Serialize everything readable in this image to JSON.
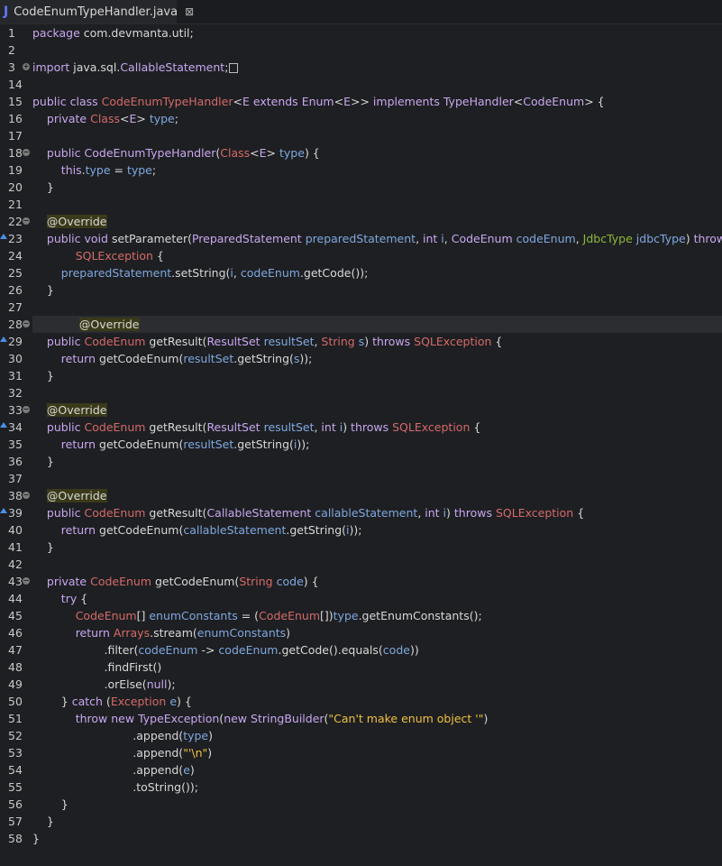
{
  "tab": {
    "icon": "java-file-icon",
    "title": "CodeEnumTypeHandler.java",
    "close_glyph": "⊠"
  },
  "lines": [
    {
      "n": "1",
      "t": "package com.devmanta.util;"
    },
    {
      "n": "2",
      "t": ""
    },
    {
      "n": "3",
      "t": "import java.sql.CallableStatement;"
    },
    {
      "n": "14",
      "t": ""
    },
    {
      "n": "15",
      "t": "public class CodeEnumTypeHandler<E extends Enum<E>> implements TypeHandler<CodeEnum> {"
    },
    {
      "n": "16",
      "t": "    private Class<E> type;"
    },
    {
      "n": "17",
      "t": ""
    },
    {
      "n": "18",
      "t": "    public CodeEnumTypeHandler(Class<E> type) {"
    },
    {
      "n": "19",
      "t": "        this.type = type;"
    },
    {
      "n": "20",
      "t": "    }"
    },
    {
      "n": "21",
      "t": ""
    },
    {
      "n": "22",
      "t": "    @Override"
    },
    {
      "n": "23",
      "t": "    public void setParameter(PreparedStatement preparedStatement, int i, CodeEnum codeEnum, JdbcType jdbcType) throws"
    },
    {
      "n": "24",
      "t": "            SQLException {"
    },
    {
      "n": "25",
      "t": "        preparedStatement.setString(i, codeEnum.getCode());"
    },
    {
      "n": "26",
      "t": "    }"
    },
    {
      "n": "27",
      "t": ""
    },
    {
      "n": "28",
      "t": "    @Override"
    },
    {
      "n": "29",
      "t": "    public CodeEnum getResult(ResultSet resultSet, String s) throws SQLException {"
    },
    {
      "n": "30",
      "t": "        return getCodeEnum(resultSet.getString(s));"
    },
    {
      "n": "31",
      "t": "    }"
    },
    {
      "n": "32",
      "t": ""
    },
    {
      "n": "33",
      "t": "    @Override"
    },
    {
      "n": "34",
      "t": "    public CodeEnum getResult(ResultSet resultSet, int i) throws SQLException {"
    },
    {
      "n": "35",
      "t": "        return getCodeEnum(resultSet.getString(i));"
    },
    {
      "n": "36",
      "t": "    }"
    },
    {
      "n": "37",
      "t": ""
    },
    {
      "n": "38",
      "t": "    @Override"
    },
    {
      "n": "39",
      "t": "    public CodeEnum getResult(CallableStatement callableStatement, int i) throws SQLException {"
    },
    {
      "n": "40",
      "t": "        return getCodeEnum(callableStatement.getString(i));"
    },
    {
      "n": "41",
      "t": "    }"
    },
    {
      "n": "42",
      "t": ""
    },
    {
      "n": "43",
      "t": "    private CodeEnum getCodeEnum(String code) {"
    },
    {
      "n": "44",
      "t": "        try {"
    },
    {
      "n": "45",
      "t": "            CodeEnum[] enumConstants = (CodeEnum[])type.getEnumConstants();"
    },
    {
      "n": "46",
      "t": "            return Arrays.stream(enumConstants)"
    },
    {
      "n": "47",
      "t": "                    .filter(codeEnum -> codeEnum.getCode().equals(code))"
    },
    {
      "n": "48",
      "t": "                    .findFirst()"
    },
    {
      "n": "49",
      "t": "                    .orElse(null);"
    },
    {
      "n": "50",
      "t": "        } catch (Exception e) {"
    },
    {
      "n": "51",
      "t": "            throw new TypeException(new StringBuilder(\"Can't make enum object '\")"
    },
    {
      "n": "52",
      "t": "                            .append(type)"
    },
    {
      "n": "53",
      "t": "                            .append(\"'\\n\")"
    },
    {
      "n": "54",
      "t": "                            .append(e)"
    },
    {
      "n": "55",
      "t": "                            .toString());"
    },
    {
      "n": "56",
      "t": "        }"
    },
    {
      "n": "57",
      "t": "    }"
    },
    {
      "n": "58",
      "t": "}"
    }
  ],
  "colors": {
    "background": "#1e1f22",
    "keyword": "#c8a8f0",
    "type": "#d46a6a",
    "field": "#7fa8e0",
    "string": "#f0c040",
    "annotation_bg": "#3a3a1a"
  }
}
